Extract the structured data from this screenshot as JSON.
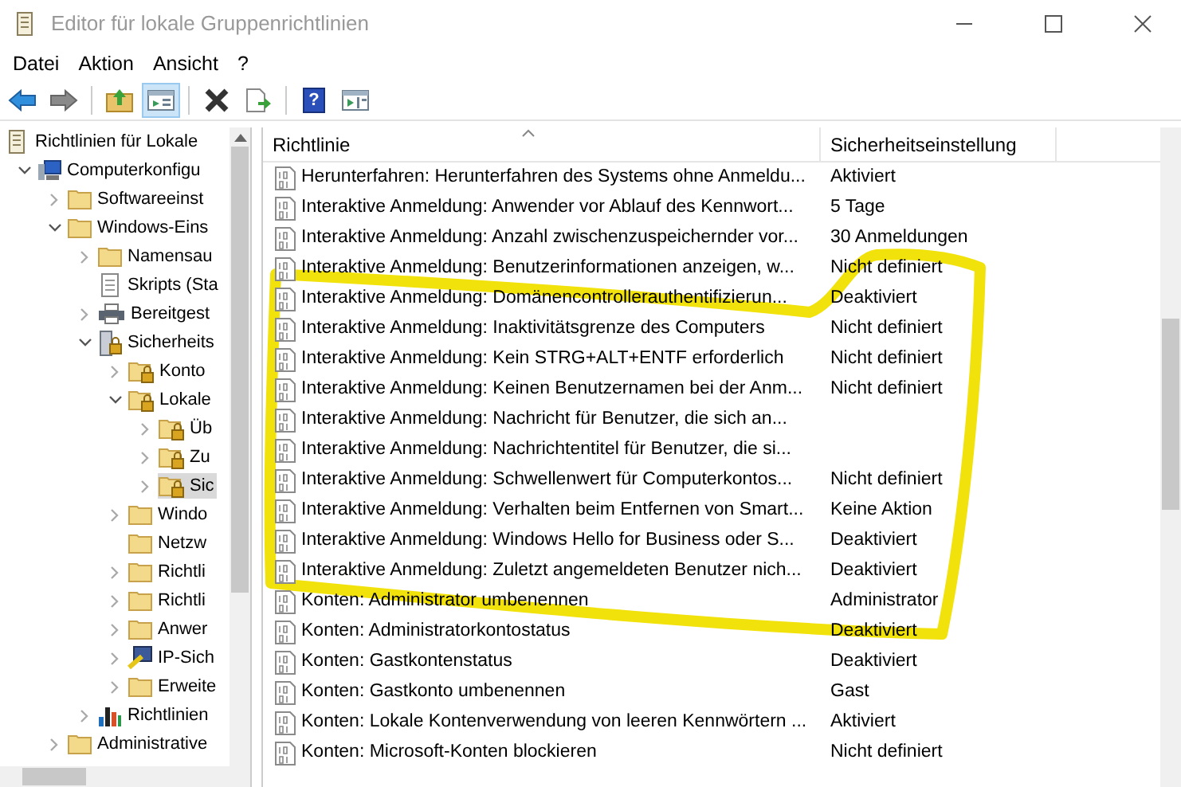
{
  "window": {
    "title": "Editor für lokale Gruppenrichtlinien"
  },
  "menu": [
    "Datei",
    "Aktion",
    "Ansicht",
    "?"
  ],
  "toolbar": [
    {
      "kind": "back",
      "selected": false
    },
    {
      "kind": "forward",
      "selected": false
    },
    {
      "kind": "sep"
    },
    {
      "kind": "up",
      "selected": false
    },
    {
      "kind": "tree",
      "selected": true
    },
    {
      "kind": "sep"
    },
    {
      "kind": "delete",
      "selected": false
    },
    {
      "kind": "export",
      "selected": false
    },
    {
      "kind": "sep"
    },
    {
      "kind": "help",
      "glyph": "?",
      "selected": false
    },
    {
      "kind": "view",
      "selected": false
    }
  ],
  "tree": [
    {
      "label": "Richtlinien für Lokale",
      "kind": "doc",
      "selected": false,
      "children": [
        {
          "label": "Computerkonfigu",
          "kind": "computer",
          "expanded": true,
          "selected": false,
          "children": [
            {
              "label": "Softwareeinst",
              "kind": "folder",
              "expanded": false,
              "selected": false
            },
            {
              "label": "Windows-Eins",
              "kind": "folder",
              "expanded": true,
              "selected": false,
              "children": [
                {
                  "label": "Namensau",
                  "kind": "folder",
                  "expanded": false,
                  "selected": false
                },
                {
                  "label": "Skripts (Sta",
                  "kind": "script",
                  "selected": false
                },
                {
                  "label": "Bereitgest",
                  "kind": "printer",
                  "expanded": false,
                  "selected": false
                },
                {
                  "label": "Sicherheits",
                  "kind": "secserver",
                  "expanded": true,
                  "selected": false,
                  "children": [
                    {
                      "label": "Konto",
                      "kind": "lockfolder",
                      "expanded": false,
                      "selected": false
                    },
                    {
                      "label": "Lokale",
                      "kind": "lockfolder",
                      "expanded": true,
                      "selected": false,
                      "children": [
                        {
                          "label": "Üb",
                          "kind": "lockfolder",
                          "expanded": false,
                          "selected": false
                        },
                        {
                          "label": "Zu",
                          "kind": "lockfolder",
                          "expanded": false,
                          "selected": false
                        },
                        {
                          "label": "Sic",
                          "kind": "lockfolder",
                          "expanded": false,
                          "selected": true
                        }
                      ]
                    },
                    {
                      "label": "Windo",
                      "kind": "folder",
                      "expanded": false,
                      "selected": false
                    },
                    {
                      "label": "Netzw",
                      "kind": "folder",
                      "selected": false
                    },
                    {
                      "label": "Richtli",
                      "kind": "folder",
                      "expanded": false,
                      "selected": false
                    },
                    {
                      "label": "Richtli",
                      "kind": "folder",
                      "expanded": false,
                      "selected": false
                    },
                    {
                      "label": "Anwer",
                      "kind": "folder",
                      "expanded": false,
                      "selected": false
                    },
                    {
                      "label": "IP-Sich",
                      "kind": "ipsec",
                      "expanded": false,
                      "selected": false
                    },
                    {
                      "label": "Erweite",
                      "kind": "folder",
                      "expanded": false,
                      "selected": false
                    }
                  ]
                },
                {
                  "label": "Richtlinien",
                  "kind": "chart",
                  "expanded": false,
                  "selected": false
                }
              ]
            },
            {
              "label": "Administrative",
              "kind": "folder",
              "expanded": false,
              "selected": false
            }
          ]
        }
      ]
    }
  ],
  "table": {
    "columns": [
      "Richtlinie",
      "Sicherheitseinstellung"
    ],
    "rows": [
      {
        "name": "Herunterfahren: Herunterfahren des Systems ohne Anmeldu...",
        "setting": "Aktiviert"
      },
      {
        "name": "Interaktive Anmeldung: Anwender vor Ablauf des Kennwort...",
        "setting": "5 Tage"
      },
      {
        "name": "Interaktive Anmeldung: Anzahl zwischenzuspeichernder vor...",
        "setting": "30 Anmeldungen"
      },
      {
        "name": "Interaktive Anmeldung: Benutzerinformationen anzeigen, w...",
        "setting": "Nicht definiert"
      },
      {
        "name": "Interaktive Anmeldung: Domänencontrollerauthentifizierun...",
        "setting": "Deaktiviert"
      },
      {
        "name": "Interaktive Anmeldung: Inaktivitätsgrenze des Computers",
        "setting": "Nicht definiert"
      },
      {
        "name": "Interaktive Anmeldung: Kein STRG+ALT+ENTF erforderlich",
        "setting": "Nicht definiert"
      },
      {
        "name": "Interaktive Anmeldung: Keinen Benutzernamen bei der Anm...",
        "setting": "Nicht definiert"
      },
      {
        "name": "Interaktive Anmeldung: Nachricht für Benutzer, die sich an..."
      },
      {
        "name": "Interaktive Anmeldung: Nachrichtentitel für Benutzer, die si..."
      },
      {
        "name": "Interaktive Anmeldung: Schwellenwert für Computerkontos...",
        "setting": "Nicht definiert"
      },
      {
        "name": "Interaktive Anmeldung: Verhalten beim Entfernen von Smart...",
        "setting": "Keine Aktion"
      },
      {
        "name": "Interaktive Anmeldung: Windows Hello for Business oder S...",
        "setting": "Deaktiviert"
      },
      {
        "name": "Interaktive Anmeldung: Zuletzt angemeldeten Benutzer nich...",
        "setting": "Deaktiviert"
      },
      {
        "name": "Konten: Administrator umbenennen",
        "setting": "Administrator"
      },
      {
        "name": "Konten: Administratorkontostatus",
        "setting": "Deaktiviert"
      },
      {
        "name": "Konten: Gastkontenstatus",
        "setting": "Deaktiviert"
      },
      {
        "name": "Konten: Gastkonto umbenennen",
        "setting": "Gast"
      },
      {
        "name": "Konten: Lokale Kontenverwendung von leeren Kennwörtern ...",
        "setting": "Aktiviert"
      },
      {
        "name": "Konten: Microsoft-Konten blockieren",
        "setting": "Nicht definiert"
      }
    ]
  }
}
